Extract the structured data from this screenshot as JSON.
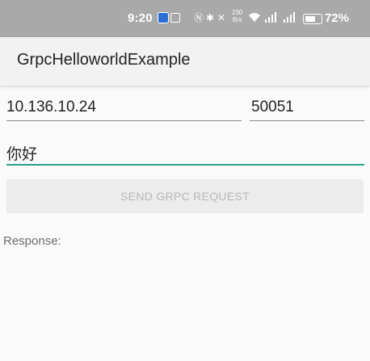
{
  "status_bar": {
    "time": "9:20",
    "network_speed_top": "230",
    "network_speed_bottom": "B/s",
    "battery_percent": "72%"
  },
  "app_bar": {
    "title": "GrpcHelloworldExample"
  },
  "form": {
    "host_value": "10.136.10.24",
    "port_value": "50051",
    "message_value": "你好",
    "send_button_label": "SEND GRPC REQUEST"
  },
  "response": {
    "label": "Response:"
  },
  "colors": {
    "accent": "#26a08c",
    "status_bar": "#a9a9a9",
    "app_bar": "#f2f2f2",
    "background": "#fafafa"
  }
}
